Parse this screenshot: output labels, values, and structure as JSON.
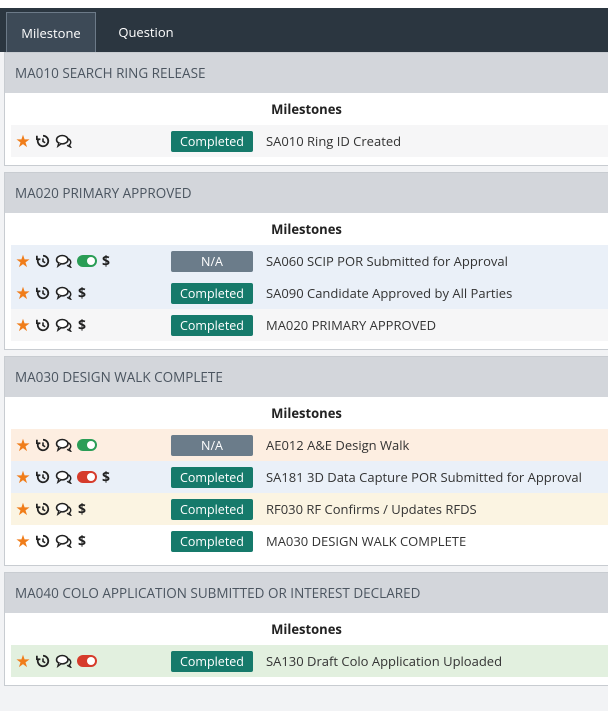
{
  "tabs": [
    {
      "label": "Milestone",
      "active": true
    },
    {
      "label": "Question",
      "active": false
    }
  ],
  "colors": {
    "star": "#f07d1a",
    "completed": "#167a6b",
    "na": "#6b7c8a",
    "toggle_on": "#2a9d56",
    "toggle_off": "#d63b2b",
    "row_blue": "#eaf0f8",
    "row_peach": "#fdeee1",
    "row_yellow": "#fbf4e2",
    "row_green": "#e2f0df",
    "row_grey": "#f6f6f7"
  },
  "milestones_label": "Milestones",
  "panels": [
    {
      "title": "MA010 SEARCH RING RELEASE",
      "rows": [
        {
          "status": "Completed",
          "status_type": "completed",
          "description": "SA010 Ring ID Created",
          "toggle": null,
          "dollar": false,
          "bg": "row_grey"
        }
      ]
    },
    {
      "title": "MA020 PRIMARY APPROVED",
      "rows": [
        {
          "status": "N/A",
          "status_type": "na",
          "description": "SA060 SCIP POR Submitted for Approval",
          "toggle": "on",
          "dollar": true,
          "bg": "row_blue"
        },
        {
          "status": "Completed",
          "status_type": "completed",
          "description": "SA090 Candidate Approved by All Parties",
          "toggle": null,
          "dollar": true,
          "bg": "row_blue"
        },
        {
          "status": "Completed",
          "status_type": "completed",
          "description": "MA020 PRIMARY APPROVED",
          "toggle": null,
          "dollar": true,
          "bg": "row_grey"
        }
      ]
    },
    {
      "title": "MA030 DESIGN WALK COMPLETE",
      "rows": [
        {
          "status": "N/A",
          "status_type": "na",
          "description": "AE012 A&E Design Walk",
          "toggle": "on",
          "dollar": false,
          "bg": "row_peach"
        },
        {
          "status": "Completed",
          "status_type": "completed",
          "description": "SA181 3D Data Capture POR Submitted for Approval",
          "toggle": "off",
          "dollar": true,
          "bg": "row_blue"
        },
        {
          "status": "Completed",
          "status_type": "completed",
          "description": "RF030 RF Confirms / Updates RFDS",
          "toggle": null,
          "dollar": true,
          "bg": "row_yellow"
        },
        {
          "status": "Completed",
          "status_type": "completed",
          "description": "MA030 DESIGN WALK COMPLETE",
          "toggle": null,
          "dollar": true,
          "bg": "white"
        }
      ]
    },
    {
      "title": "MA040 COLO APPLICATION SUBMITTED OR INTEREST DECLARED",
      "rows": [
        {
          "status": "Completed",
          "status_type": "completed",
          "description": "SA130 Draft Colo Application Uploaded",
          "toggle": "off",
          "dollar": false,
          "bg": "row_green"
        }
      ]
    }
  ],
  "icons": {
    "star": "star-icon",
    "history": "history-icon",
    "comments": "comments-icon",
    "toggle": "toggle-icon",
    "dollar": "dollar-icon"
  }
}
